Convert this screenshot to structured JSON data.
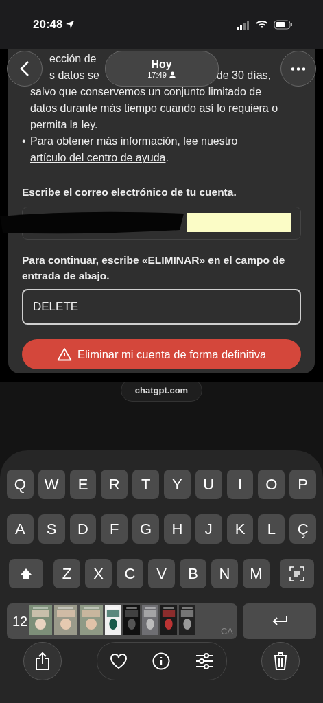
{
  "status_bar": {
    "time": "20:48"
  },
  "viewer_header": {
    "title": "Hoy",
    "subtitle": "17:49"
  },
  "page": {
    "lines": [
      {
        "kind": "split",
        "left": "ección de"
      },
      {
        "kind": "split",
        "left": "s datos se",
        "right": "de 30 días,"
      },
      {
        "kind": "plain",
        "text": "salvo que conservemos un conjunto limitado de datos durante más tiempo cuando así lo requiera o permita la ley."
      },
      {
        "kind": "bullet",
        "bullet": "•",
        "text": "Para obtener más información, lee nuestro ",
        "link": "artículo del centro de ayuda",
        "after": "."
      }
    ],
    "email_label": "Escribe el correo electrónico de tu cuenta.",
    "confirm_label": "Para continuar, escribe «ELIMINAR» en el campo de entrada de abajo.",
    "confirm_value": "DELETE",
    "delete_button": "Eliminar mi cuenta de forma definitiva",
    "url": "chatgpt.com"
  },
  "keyboard": {
    "rows": [
      [
        "Q",
        "W",
        "E",
        "R",
        "T",
        "Y",
        "U",
        "I",
        "O",
        "P"
      ],
      [
        "A",
        "S",
        "D",
        "F",
        "G",
        "H",
        "J",
        "K",
        "L",
        "Ç"
      ],
      [
        "Z",
        "X",
        "C",
        "V",
        "B",
        "N",
        "M"
      ]
    ],
    "numbers_key": "12",
    "language": "CA"
  },
  "toolbar": {
    "favorite": false
  }
}
